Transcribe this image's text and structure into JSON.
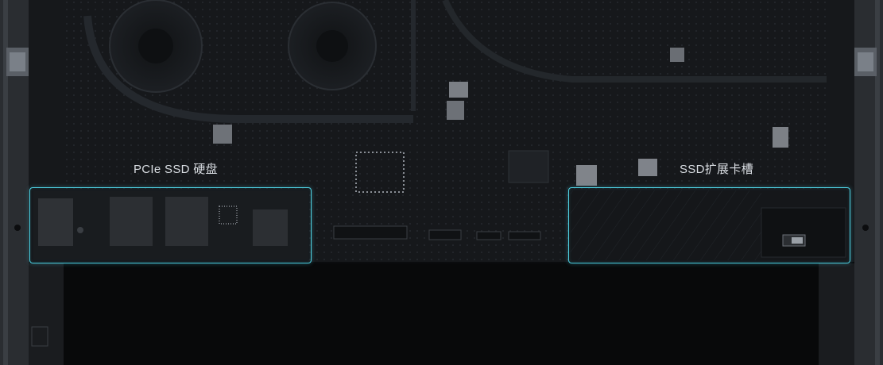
{
  "labels": {
    "pcie_ssd": "PCIe SSD 硬盘",
    "ssd_slot": "SSD扩展卡槽"
  },
  "colors": {
    "highlight": "#4fd4e6",
    "board": "#15171a",
    "background": "#050607"
  }
}
